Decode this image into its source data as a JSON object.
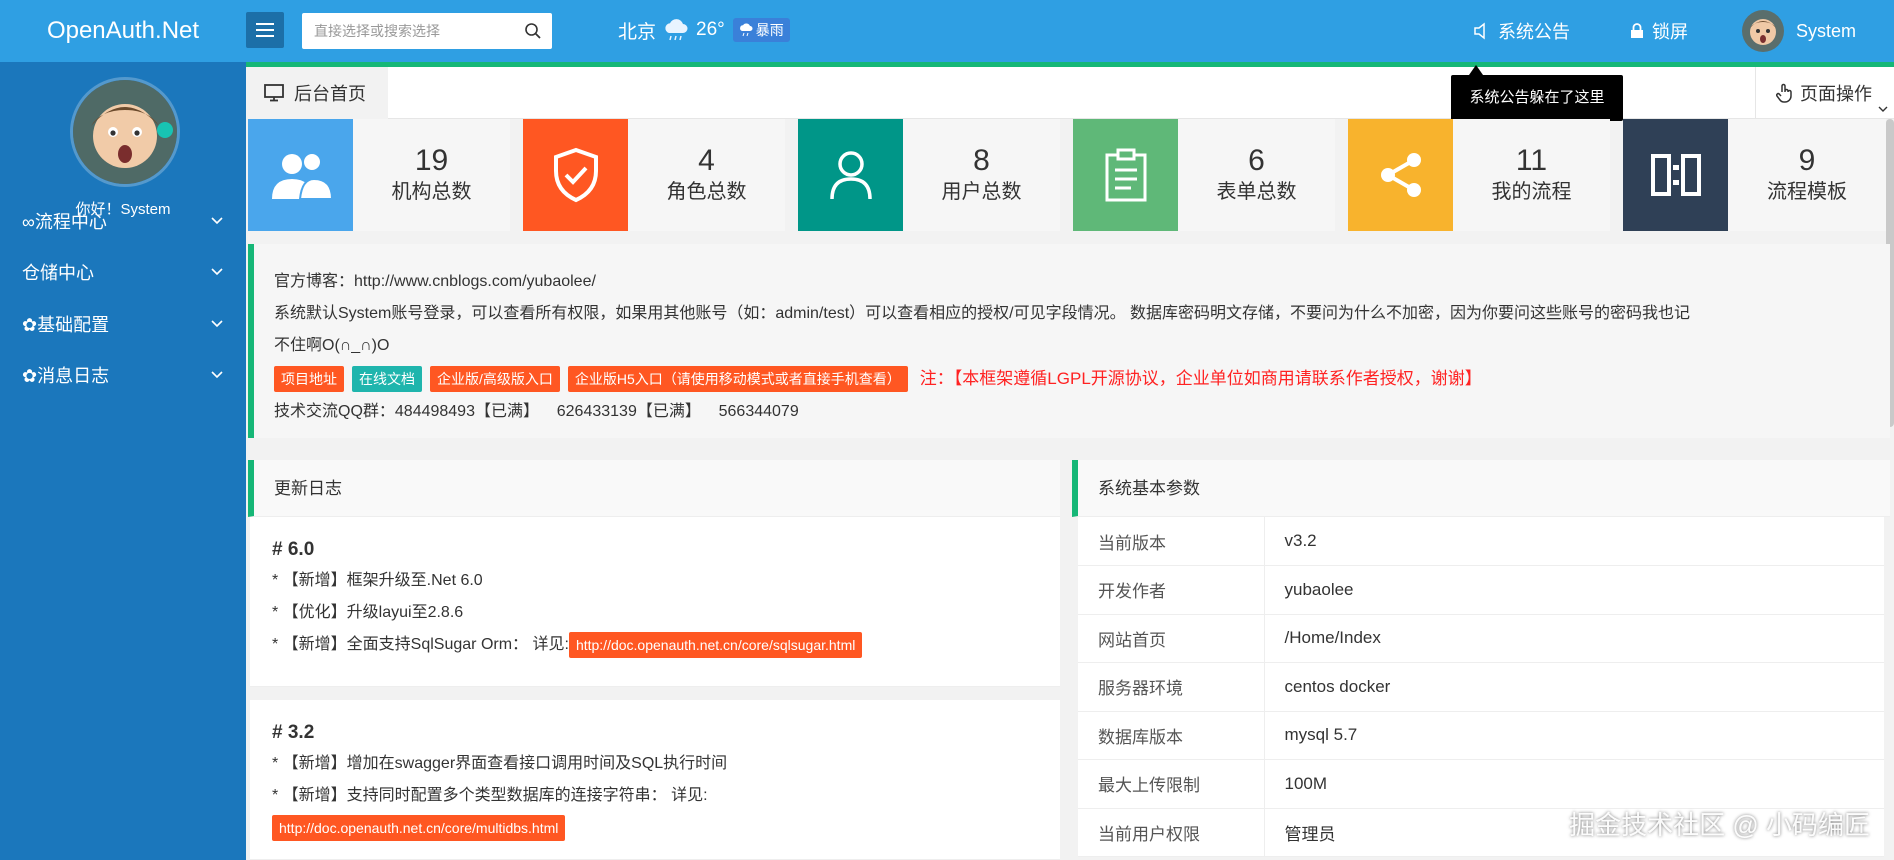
{
  "header": {
    "logo": "OpenAuth.Net",
    "search_placeholder": "直接选择或搜索选择",
    "weather": {
      "city": "北京",
      "temp": "26°",
      "condition": "暴雨"
    },
    "notice_label": "系统公告",
    "lock_label": "锁屏",
    "user_name": "System"
  },
  "sidebar": {
    "greeting": "你好！System",
    "items": [
      {
        "label": "∞流程中心"
      },
      {
        "label": "仓储中心"
      },
      {
        "label": "✿基础配置"
      },
      {
        "label": "✿消息日志"
      }
    ]
  },
  "tabs": {
    "home_label": "后台首页",
    "page_op_label": "页面操作",
    "tooltip": "系统公告躲在了这里"
  },
  "stats": [
    {
      "value": "19",
      "label": "机构总数",
      "color": "#4aa6ec",
      "icon": "users-icon"
    },
    {
      "value": "4",
      "label": "角色总数",
      "color": "#ff5722",
      "icon": "shield-check-icon"
    },
    {
      "value": "8",
      "label": "用户总数",
      "color": "#009688",
      "icon": "user-icon"
    },
    {
      "value": "6",
      "label": "表单总数",
      "color": "#5fb878",
      "icon": "clipboard-icon"
    },
    {
      "value": "11",
      "label": "我的流程",
      "color": "#f8b32d",
      "icon": "share-icon"
    },
    {
      "value": "9",
      "label": "流程模板",
      "color": "#2f4056",
      "icon": "template-icon"
    }
  ],
  "info": {
    "blog": "官方博客：http://www.cnblogs.com/yubaolee/",
    "desc_line1": "系统默认System账号登录，可以查看所有权限，如果用其他账号（如：admin/test）可以查看相应的授权/可见字段情况。 数据库密码明文存储，不要问为什么不加密，因为你要问这些账号的密码我也记",
    "desc_line2": "不住啊O(∩_∩)O",
    "tags": [
      "项目地址",
      "在线文档",
      "企业版/高级版入口",
      "企业版H5入口（请使用移动模式或者直接手机查看）"
    ],
    "warning": "注：【本框架遵循LGPL开源协议，企业单位如商用请联系作者授权，谢谢】",
    "qq": "技术交流QQ群：484498493【已满】    626433139【已满】    566344079"
  },
  "changelog": {
    "title": "更新日志",
    "v60": {
      "title": "# 6.0",
      "items": [
        "* 【新增】框架升级至.Net 6.0",
        "* 【优化】升级layui至2.8.6",
        "* 【新增】全面支持SqlSugar Orm： 详见:"
      ],
      "link": "http://doc.openauth.net.cn/core/sqlsugar.html"
    },
    "v32": {
      "title": "# 3.2",
      "items": [
        "* 【新增】增加在swagger界面查看接口调用时间及SQL执行时间",
        "* 【新增】支持同时配置多个类型数据库的连接字符串： 详见:"
      ],
      "link": "http://doc.openauth.net.cn/core/multidbs.html"
    }
  },
  "params": {
    "title": "系统基本参数",
    "rows": [
      {
        "k": "当前版本",
        "v": "v3.2"
      },
      {
        "k": "开发作者",
        "v": "yubaolee"
      },
      {
        "k": "网站首页",
        "v": "/Home/Index"
      },
      {
        "k": "服务器环境",
        "v": "centos docker"
      },
      {
        "k": "数据库版本",
        "v": "mysql 5.7"
      },
      {
        "k": "最大上传限制",
        "v": "100M"
      },
      {
        "k": "当前用户权限",
        "v": "管理员"
      }
    ]
  },
  "watermark": "掘金技术社区 @ 小码编匠"
}
